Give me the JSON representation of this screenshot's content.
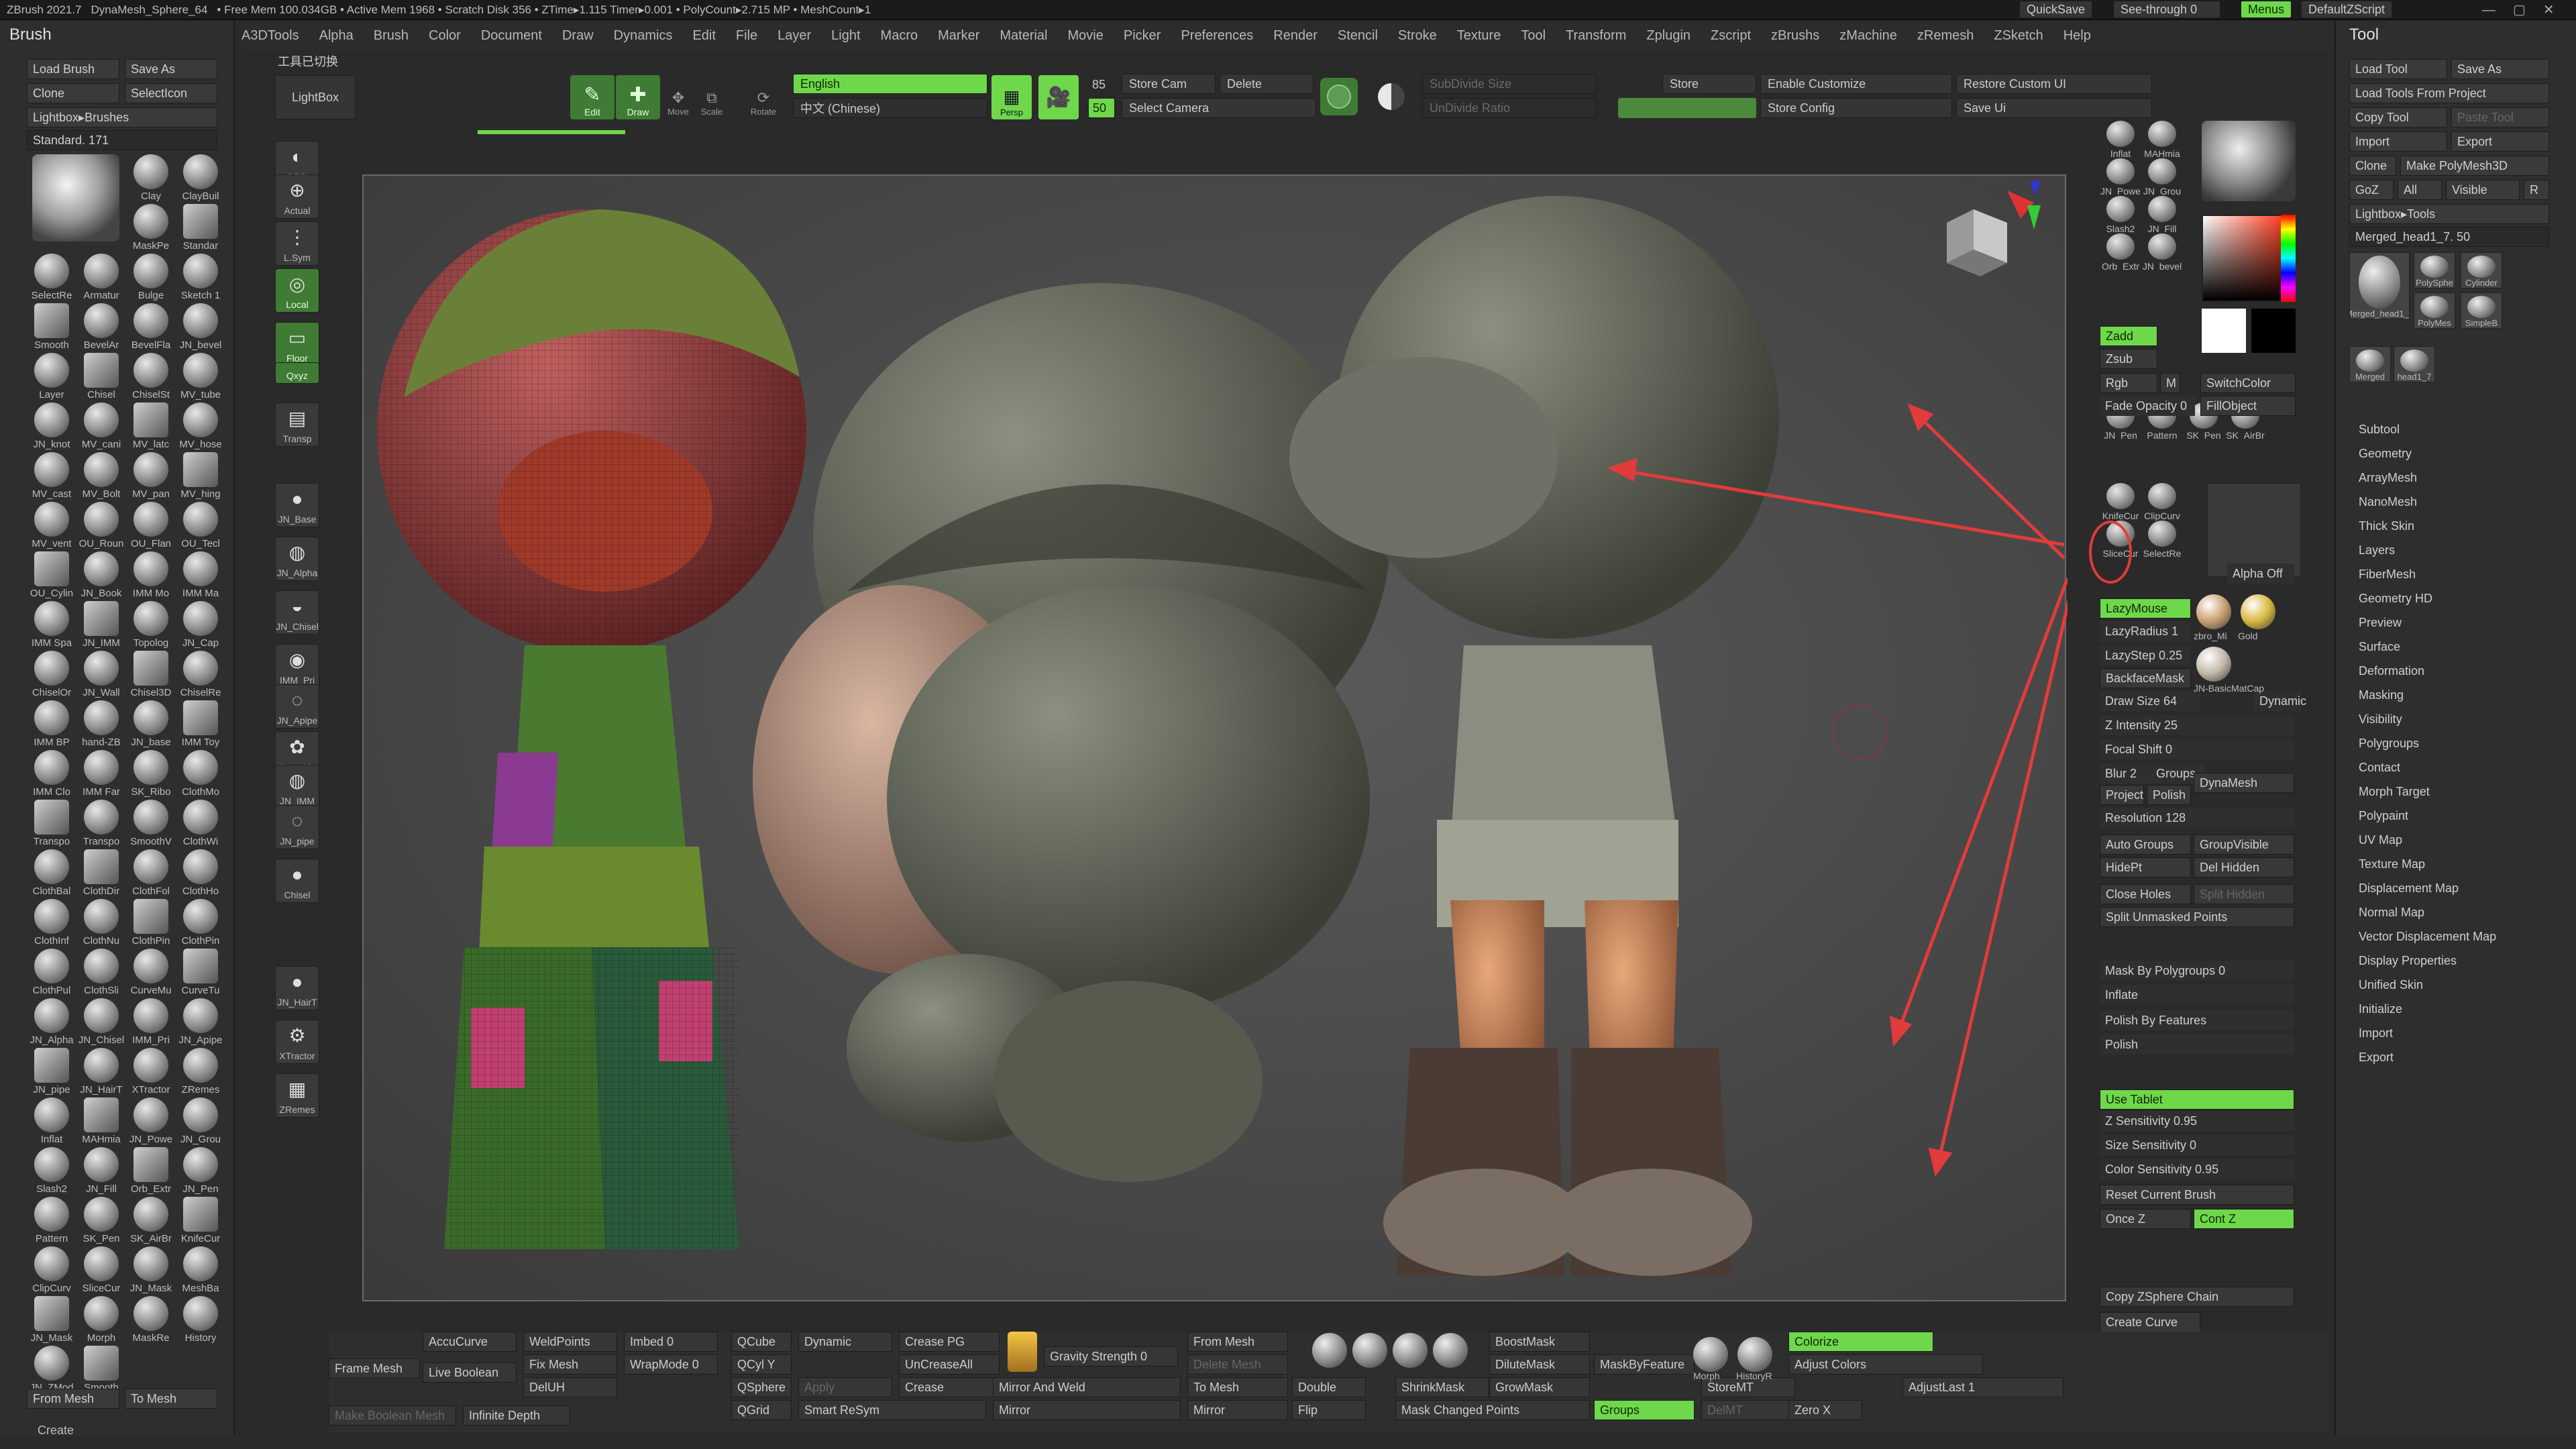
{
  "titlebar": {
    "app": "ZBrush 2021.7",
    "mesh": "DynaMesh_Sphere_64",
    "stats": "• Free Mem 100.034GB • Active Mem 1968 • Scratch Disk 356 • ZTime▸1.115 Timer▸0.001 • PolyCount▸2.715 MP • MeshCount▸1",
    "quicksave": "QuickSave",
    "seethrough": "See-through 0",
    "menus": "Menus",
    "script": "DefaultZScript"
  },
  "menubar": [
    "A3DTools",
    "Alpha",
    "Brush",
    "Color",
    "Document",
    "Draw",
    "Dynamics",
    "Edit",
    "File",
    "Layer",
    "Light",
    "Macro",
    "Marker",
    "Material",
    "Movie",
    "Picker",
    "Preferences",
    "Render",
    "Stencil",
    "Stroke",
    "Texture",
    "Tool",
    "Transform",
    "Zplugin",
    "Zscript",
    "zBrushs",
    "zMachine",
    "zRemesh",
    "ZSketch",
    "Help"
  ],
  "topshelf": {
    "cn_switch": "工具已切换",
    "lightbox": "LightBox",
    "edit": "Edit",
    "draw": "Draw",
    "move": "Move",
    "scale": "Scale",
    "rotate": "Rotate",
    "lang_en": "English",
    "lang_cn": "中文 (Chinese)",
    "persp": "Persp",
    "num1": "85",
    "num2": "50",
    "store_cam": "Store Cam",
    "delete": "Delete",
    "select_camera": "Select Camera",
    "store": "Store",
    "enable_customize": "Enable Customize",
    "restore_custom_ui": "Restore Custom UI",
    "store_config": "Store Config",
    "save_ui": "Save Ui"
  },
  "brush": {
    "title": "Brush",
    "load": "Load Brush",
    "saveas": "Save As",
    "clone": "Clone",
    "selecticon": "SelectIcon",
    "lightbox": "Lightbox▸Brushes",
    "standard": "Standard. 171",
    "items": [
      "Clay",
      "ClayBuil",
      "MaskPe",
      "Standar",
      "SelectRe",
      "Armatur",
      "Bulge",
      "Sketch 1",
      "Smooth",
      "BevelAr",
      "BevelFla",
      "JN_bevel",
      "Layer",
      "Chisel",
      "ChiselSt",
      "MV_tube",
      "JN_knot",
      "MV_cani",
      "MV_latc",
      "MV_hose",
      "MV_cast",
      "MV_Bolt",
      "MV_pan",
      "MV_hing",
      "MV_vent",
      "OU_Roun",
      "OU_Flan",
      "OU_Tecl",
      "OU_Cylin",
      "JN_Book",
      "IMM Mo",
      "IMM Ma",
      "IMM Spa",
      "JN_IMM",
      "Topolog",
      "JN_Cap",
      "ChiselOr",
      "JN_Wall",
      "Chisel3D",
      "ChiselRe",
      "IMM BP",
      "hand-ZB",
      "JN_base",
      "IMM Toy",
      "IMM Clo",
      "IMM Far",
      "SK_Ribo",
      "ClothMo",
      "Transpo",
      "Transpo",
      "SmoothV",
      "ClothWi",
      "ClothBal",
      "ClothDir",
      "ClothFol",
      "ClothHo",
      "ClothInf",
      "ClothNu",
      "ClothPin",
      "ClothPin",
      "ClothPul",
      "ClothSli",
      "CurveMu",
      "CurveTu",
      "JN_Alpha",
      "JN_Chisel",
      "IMM_Pri",
      "JN_Apipe",
      "JN_pipe",
      "JN_HairT",
      "XTractor",
      "ZRemes",
      "Inflat",
      "MAHmia",
      "JN_Powe",
      "JN_Grou",
      "Slash2",
      "JN_Fill",
      "Orb_Extr",
      "JN_Pen",
      "Pattern",
      "SK_Pen",
      "SK_AirBr",
      "KnifeCur",
      "ClipCurv",
      "SliceCur",
      "JN_Mask",
      "MeshBa",
      "JN_Mask",
      "Morph",
      "MaskRe",
      "History",
      "JN_ZMod",
      "Smooth"
    ],
    "from_mesh": "From Mesh",
    "to_mesh": "To Mesh",
    "create": "Create"
  },
  "shelf": [
    "BPR",
    "Actual",
    "L.Sym",
    "Local",
    "Floor",
    "Qxyz",
    "Transp",
    "JN_Base",
    "JN_Alpha",
    "JN_Chisel",
    "IMM_Pri",
    "JN_Apipe",
    "CurveMu",
    "JN_IMM",
    "JN_pipe",
    "Chisel",
    "JN_HairT",
    "XTractor",
    "ZRemes"
  ],
  "rightpalette": {
    "buttons": [
      "Inflat",
      "MAHmia",
      "JN_Powe",
      "JN_Grou",
      "Slash2",
      "JN_Fill",
      "Orb_Extr",
      "JN_bevel",
      "JN_Pen",
      "Pattern",
      "SK_Pen",
      "SK_AirBr",
      "KnifeCur",
      "ClipCurv",
      "SliceCur",
      "SelectRe"
    ],
    "zadd": "Zadd",
    "zsub": "Zsub",
    "rgb": "Rgb",
    "m": "M",
    "switchcolor": "SwitchColor",
    "fade_opacity": "Fade Opacity 0",
    "fillobject": "FillObject",
    "alpha_off": "Alpha Off",
    "lazymouse": "LazyMouse",
    "lazyradius": "LazyRadius 1",
    "lazystep": "LazyStep 0.25",
    "backfacemask": "BackfaceMask",
    "mat1": "zbro_Mi",
    "mat2": "Gold",
    "mat3": "JN-BasicMatCap",
    "draw_size": "Draw Size 64",
    "dynamic": "Dynamic",
    "z_intensity": "Z Intensity 25",
    "focal_shift": "Focal Shift 0",
    "blur": "Blur 2",
    "groups": "Groups",
    "project": "Project",
    "polish": "Polish",
    "dynamesh": "DynaMesh",
    "resolution": "Resolution 128",
    "auto_groups": "Auto Groups",
    "group_visible": "GroupVisible",
    "hidept": "HidePt",
    "del_hidden": "Del Hidden",
    "close_holes": "Close Holes",
    "split_hidden": "Split Hidden",
    "split_unmasked": "Split Unmasked Points",
    "mask_by_polygroups": "Mask By Polygroups 0",
    "inflate": "Inflate",
    "polish_by_features": "Polish By Features",
    "polish2": "Polish",
    "use_tablet": "Use Tablet",
    "z_sensitivity": "Z Sensitivity 0.95",
    "size_sensitivity": "Size Sensitivity 0",
    "color_sensitivity": "Color Sensitivity 0.95",
    "reset_brush": "Reset Current Brush",
    "once_z": "Once Z",
    "cont_z": "Cont Z",
    "copy_zsphere": "Copy ZSphere Chain",
    "create_curve": "Create Curve"
  },
  "tool": {
    "title": "Tool",
    "load": "Load Tool",
    "saveas": "Save As",
    "load_project": "Load Tools From Project",
    "copy": "Copy Tool",
    "paste": "Paste Tool",
    "import": "Import",
    "export": "Export",
    "clone": "Clone",
    "make_polymesh": "Make PolyMesh3D",
    "goz": "GoZ",
    "all": "All",
    "visible": "Visible",
    "r": "R",
    "lightbox_tools": "Lightbox▸Tools",
    "current": "Merged_head1_7. 50",
    "thumbs": [
      "Merged_head1_7",
      "PolySphe",
      "Cylinder",
      "PolyMes",
      "SimpleB",
      "Merged",
      "head1_7"
    ],
    "items": [
      "Subtool",
      "Geometry",
      "ArrayMesh",
      "NanoMesh",
      "Thick Skin",
      "Layers",
      "FiberMesh",
      "Geometry HD",
      "Preview",
      "Surface",
      "Deformation",
      "Masking",
      "Visibility",
      "Polygroups",
      "Contact",
      "Morph Target",
      "Polypaint",
      "UV Map",
      "Texture Map",
      "Displacement Map",
      "Normal Map",
      "Vector Displacement Map",
      "Display Properties",
      "Unified Skin",
      "Initialize",
      "Import",
      "Export"
    ]
  },
  "bottombar": {
    "frame_mesh": "Frame Mesh",
    "accucurve": "AccuCurve",
    "weldpoints": "WeldPoints",
    "imbed": "Imbed 0",
    "qcube": "QCube",
    "dynamic": "Dynamic",
    "crease_pg": "Crease PG",
    "from_mesh": "From Mesh",
    "boostmask": "BoostMask",
    "live_boolean": "Live Boolean",
    "fix_mesh": "Fix Mesh",
    "wrapmode": "WrapMode 0",
    "qcyl_y": "QCyl Y",
    "uncreaseall": "UnCreaseAll",
    "gravity": "Gravity Strength 0",
    "delete_mesh": "Delete Mesh",
    "dilutemask": "DiluteMask",
    "masky": "MaskByFeature",
    "delu": "DelUH",
    "qsphere": "QSphere",
    "crease": "Crease",
    "mirror_weld": "Mirror And Weld",
    "to_mesh": "To Mesh",
    "double": "Double",
    "shrinkmask": "ShrinkMask",
    "growmask": "GrowMask",
    "colorize": "Colorize",
    "adjust_colors": "Adjust Colors",
    "adjustlast": "AdjustLast 1",
    "make_boolean": "Make Boolean Mesh",
    "infinite_depth": "Infinite Depth",
    "qgrid": "QGrid",
    "smart_resym": "Smart ReSym",
    "mirror": "Mirror",
    "mirror2": "Mirror",
    "flip": "Flip",
    "mask_changed": "Mask Changed Points",
    "groups": "Groups",
    "storemt": "StoreMT",
    "delmt": "DelMT",
    "zero_x": "Zero X",
    "morph": "Morph",
    "history": "HistoryR",
    "apply": "Apply"
  },
  "colors": {
    "green": "#6ed84a",
    "annotation_red": "#e23b3b"
  }
}
